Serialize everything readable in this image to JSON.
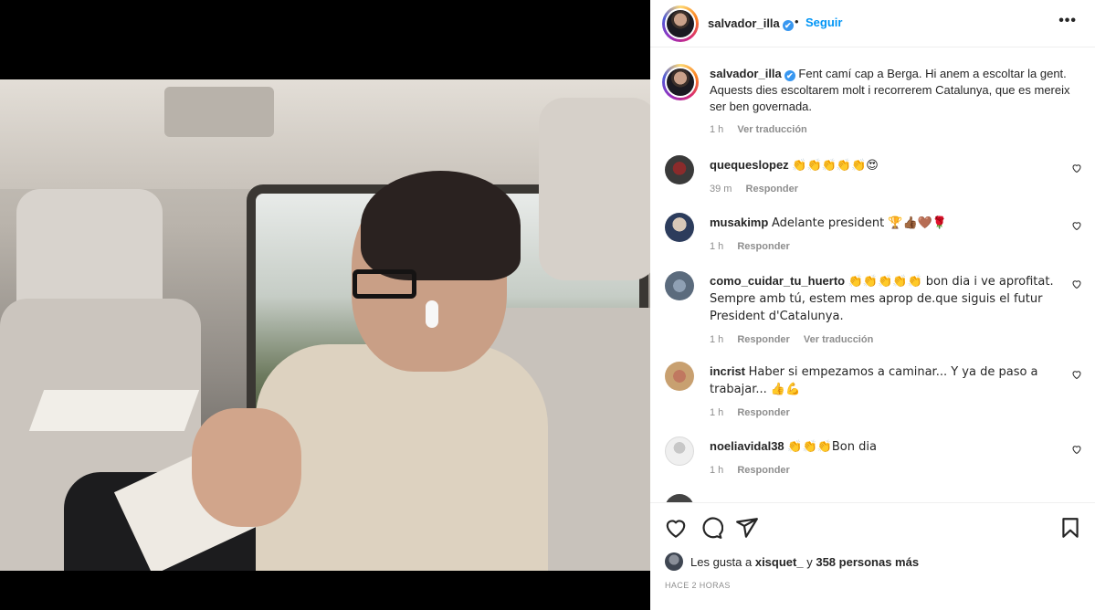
{
  "post": {
    "username": "salvador_illa",
    "verified": "✔",
    "dot": "•",
    "follow_label": "Seguir",
    "more_label": "•••"
  },
  "caption": {
    "username": "salvador_illa",
    "text": "Fent camí cap a Berga. Hi anem a escoltar la gent. Aquests dies escoltarem molt i recorrerem Catalunya, que es mereix ser ben governada.",
    "time": "1 h",
    "translate": "Ver traducción"
  },
  "comments": [
    {
      "username": "quequeslopez",
      "text": "👏👏👏👏👏😍",
      "time": "39 m",
      "reply": "Responder",
      "translate": ""
    },
    {
      "username": "musakimp",
      "text": "Adelante president 🏆👍🏾🤎🌹",
      "time": "1 h",
      "reply": "Responder",
      "translate": ""
    },
    {
      "username": "como_cuidar_tu_huerto",
      "text": "👏👏👏👏👏 bon dia i ve aprofitat. Sempre amb tú, estem mes aprop de.que siguis el futur President d'Catalunya.",
      "time": "1 h",
      "reply": "Responder",
      "translate": "Ver traducción"
    },
    {
      "username": "incrist",
      "text": "Haber si empezamos a caminar... Y ya de paso a trabajar... 👍💪",
      "time": "1 h",
      "reply": "Responder",
      "translate": ""
    },
    {
      "username": "noeliavidal38",
      "text": "👏👏👏Bon dia",
      "time": "1 h",
      "reply": "Responder",
      "translate": ""
    }
  ],
  "likes": {
    "prefix": "Les gusta a",
    "user": "xisquet_",
    "middle": "y",
    "count": "358 personas más"
  },
  "posted_ago": "HACE 2 HORAS",
  "colors": {
    "accent": "#0095f6",
    "verified": "#3897f0",
    "muted": "#8e8e8e"
  }
}
